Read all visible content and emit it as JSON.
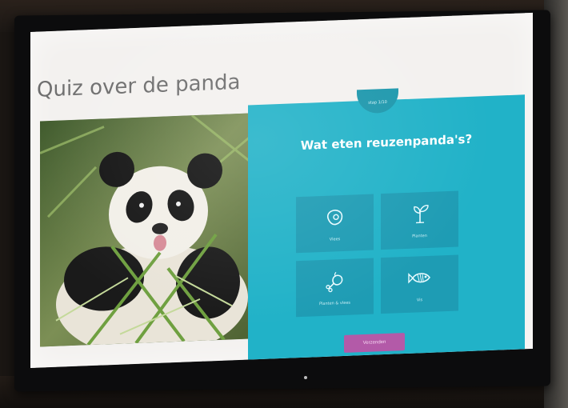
{
  "quiz": {
    "title": "Quiz over de panda",
    "meta": "",
    "step": "stap 1/10",
    "question": "Wat eten reuzenpanda's?",
    "options": [
      {
        "label": "Vlees",
        "icon": "meat-icon"
      },
      {
        "label": "Planten",
        "icon": "plant-icon"
      },
      {
        "label": "Planten & vlees",
        "icon": "chicken-leg-icon"
      },
      {
        "label": "Vis",
        "icon": "fish-icon"
      }
    ],
    "submit_label": "Verzenden"
  },
  "monitor": {
    "brand": ""
  },
  "colors": {
    "panel": "#21b2c8",
    "option": "#1e9cb4",
    "button": "#b35aa8"
  }
}
